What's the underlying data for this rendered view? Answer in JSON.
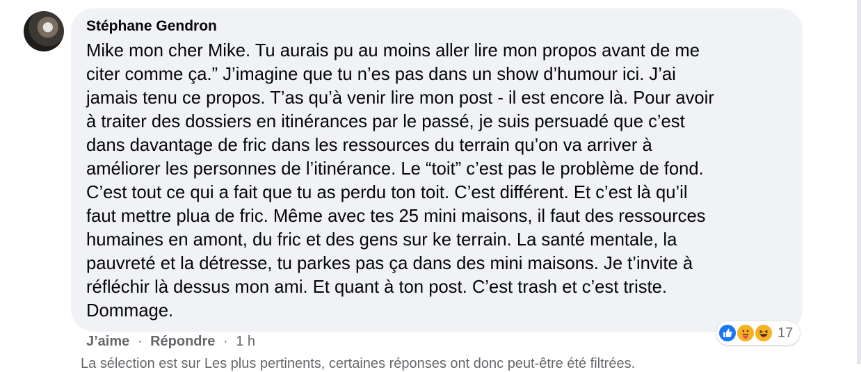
{
  "comment": {
    "author": "Stéphane Gendron",
    "lines": [
      "Mike mon cher Mike. Tu aurais pu au moins aller lire mon propos avant de me",
      "citer comme ça.” J’imagine que tu n’es pas dans un show d’humour ici. J’ai",
      "jamais tenu ce propos. T’as qu’à venir lire mon post - il est encore là. Pour avoir",
      "à traiter des dossiers en itinérances par le passé, je suis persuadé que c’est",
      "dans davantage de fric dans les ressources du terrain qu’on va arriver à",
      "améliorer les personnes de l’itinérance. Le “toit” c’est pas le problème de fond.",
      "C’est tout ce qui a fait que tu as perdu ton toit. C’est différent. Et c’est là qu’il",
      "faut mettre plua de fric. Même avec tes 25 mini maisons, il faut des ressources",
      "humaines en amont, du fric et des gens sur ke terrain. La santé mentale, la",
      "pauvreté et la détresse, tu parkes pas ça dans des mini maisons. Je t’invite à",
      "réfléchir là dessus mon ami. Et quant à ton post. C’est trash et c’est triste.",
      "Dommage."
    ],
    "reactions": {
      "icons": [
        "like-icon",
        "care-icon",
        "haha-icon"
      ],
      "count": "17"
    },
    "actions": {
      "like": "J’aime",
      "reply": "Répondre",
      "separator": "·",
      "time": "1 h"
    }
  },
  "filter_note": "La sélection est sur Les plus pertinents, certaines réponses ont donc peut-être été filtrées.",
  "colors": {
    "bubble": "#f0f2f5",
    "text": "#050505",
    "secondary_text": "#65676b",
    "like_blue": "#1877f2",
    "emoji_yellow": "#f7b125"
  }
}
